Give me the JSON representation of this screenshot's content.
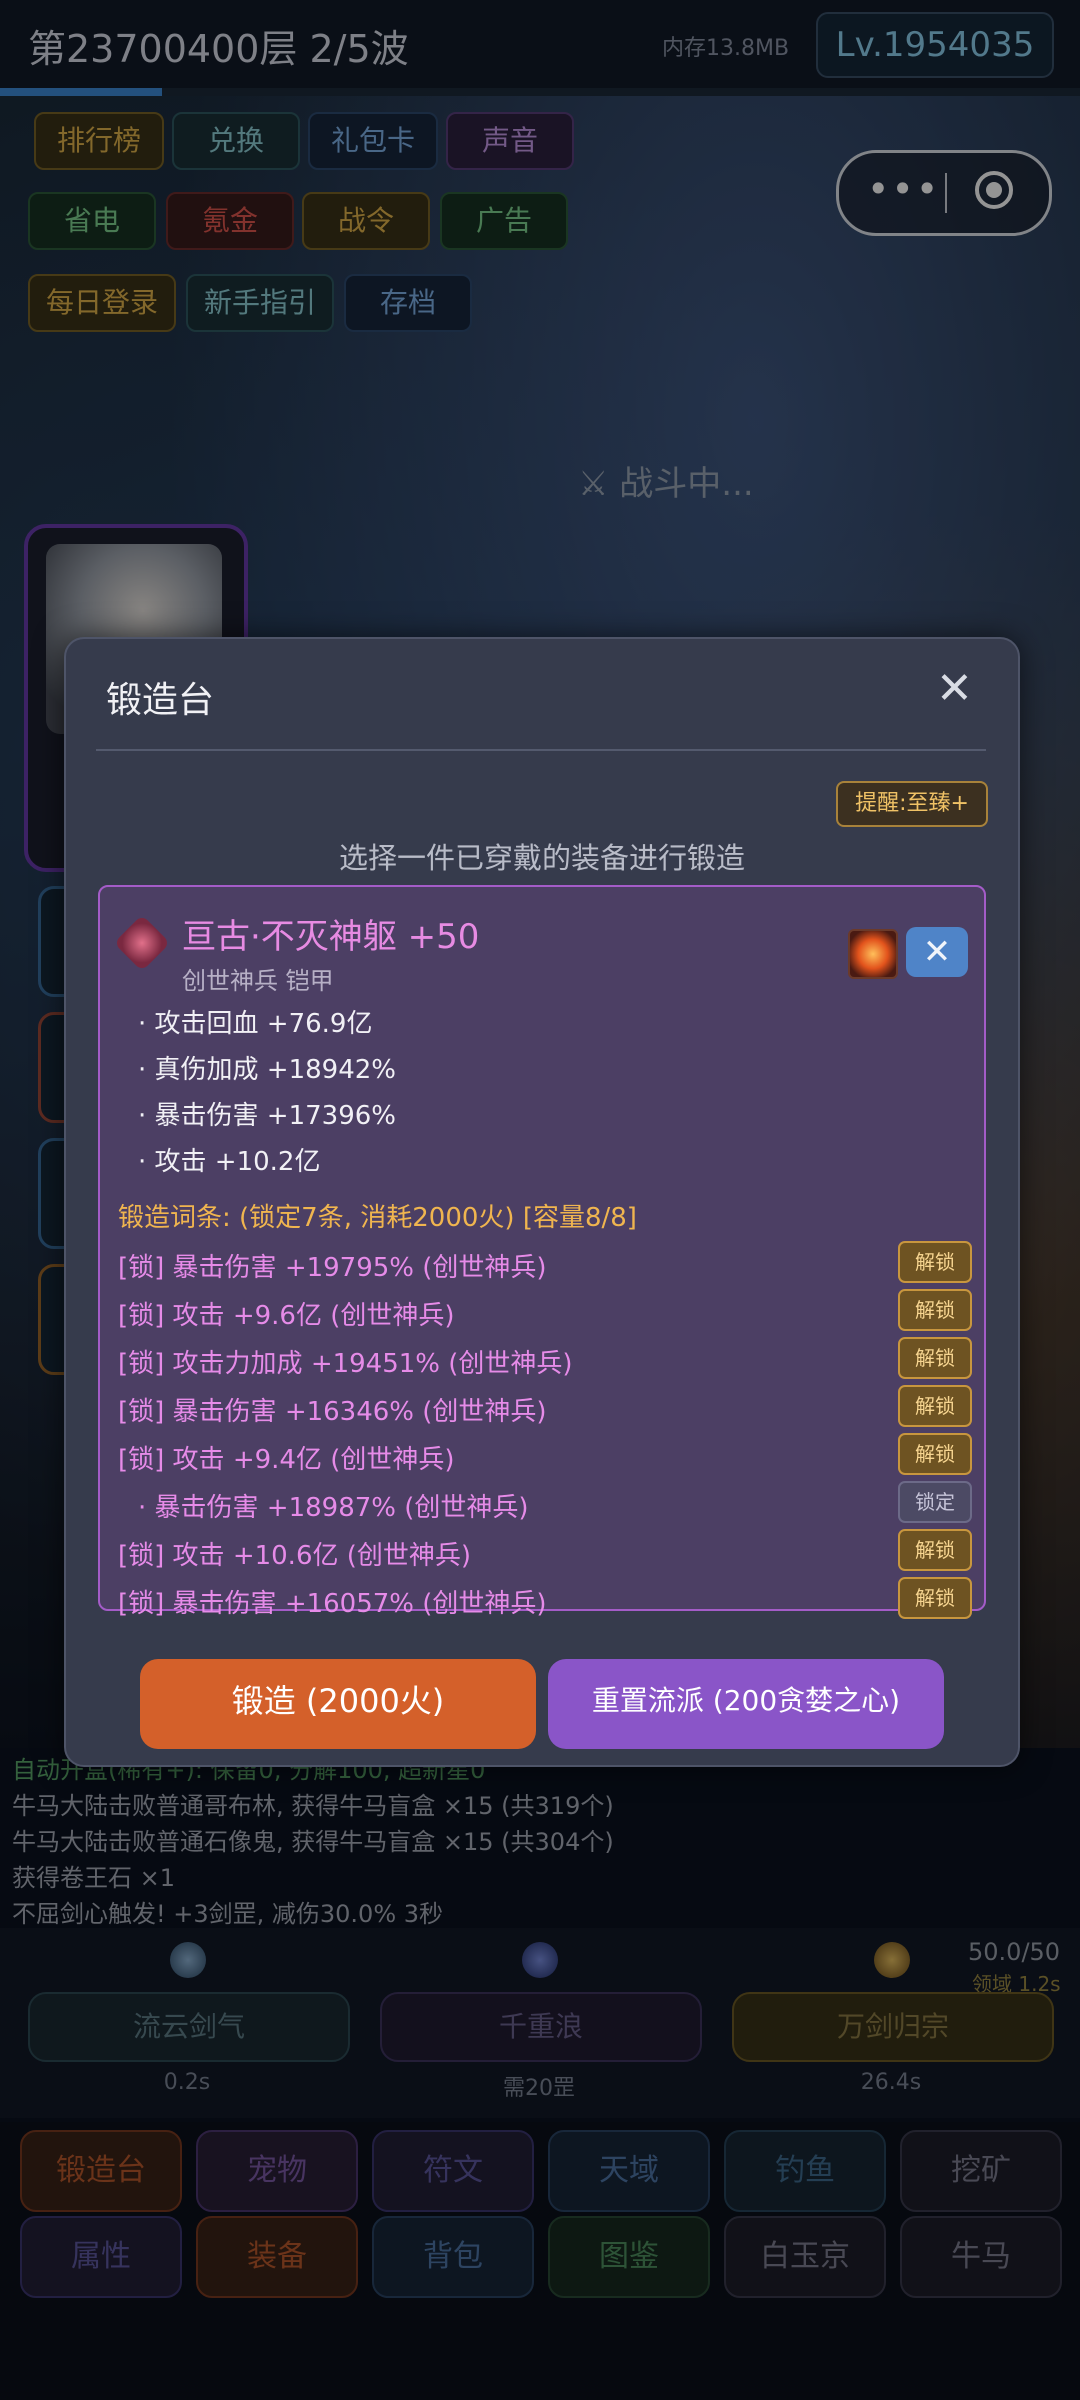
{
  "header": {
    "floor_wave": "第23700400层  2/5波",
    "memory": "内存13.8MB",
    "level": "Lv.1954035",
    "wave_progress": 0.15
  },
  "top_buttons": [
    "排行榜",
    "兑换",
    "礼包卡",
    "声音",
    "省电",
    "氪金",
    "战令",
    "广告",
    "每日登录",
    "新手指引",
    "存档"
  ],
  "battle_status": "⚔ 战斗中...",
  "modal": {
    "title": "锻造台",
    "close": "✕",
    "reminder": "提醒:至臻+",
    "instruction": "选择一件已穿戴的装备进行锻造",
    "equipment": {
      "name": "亘古·不灭神躯 +50",
      "type": "创世神兵 铠甲",
      "unequip": "✕",
      "base_stats": [
        "· 攻击回血 +76.9亿",
        "· 真伤加成 +18942%",
        "· 暴击伤害 +17396%",
        "· 攻击 +10.2亿"
      ],
      "forge_header": "锻造词条: (锁定7条, 消耗2000火) [容量8/8]",
      "affixes": [
        {
          "text": "[锁] 暴击伤害 +19795% (创世神兵)",
          "button": "解锁",
          "locked": true
        },
        {
          "text": "[锁] 攻击 +9.6亿 (创世神兵)",
          "button": "解锁",
          "locked": true
        },
        {
          "text": "[锁] 攻击力加成 +19451% (创世神兵)",
          "button": "解锁",
          "locked": true
        },
        {
          "text": "[锁] 暴击伤害 +16346% (创世神兵)",
          "button": "解锁",
          "locked": true
        },
        {
          "text": "[锁] 攻击 +9.4亿 (创世神兵)",
          "button": "解锁",
          "locked": true
        },
        {
          "text": "· 暴击伤害 +18987% (创世神兵)",
          "button": "锁定",
          "locked": false
        },
        {
          "text": "[锁] 攻击 +10.6亿 (创世神兵)",
          "button": "解锁",
          "locked": true
        },
        {
          "text": "[锁] 暴击伤害 +16057% (创世神兵)",
          "button": "解锁",
          "locked": true
        }
      ]
    },
    "forge_button": "锻造 (2000火)",
    "reset_button": "重置流派 (200贪婪之心)"
  },
  "log": [
    "自动开盒(稀有+): 保留0, 分解100, 超新星0",
    "牛马大陆击败普通哥布林, 获得牛马盲盒 ×15 (共319个)",
    "牛马大陆击败普通石像鬼, 获得牛马盲盒 ×15 (共304个)",
    "获得卷王石 ×1",
    "不屈剑心触发! +3剑罡, 减伤30.0% 3秒"
  ],
  "skills": [
    {
      "name": "流云剑气",
      "cooldown": "0.2s"
    },
    {
      "name": "千重浪",
      "cooldown": "需20罡"
    },
    {
      "name": "万剑归宗",
      "cooldown": "26.4s"
    }
  ],
  "energy": "50.0/50",
  "domain_timer": "领域 1.2s",
  "nav": [
    "锻造台",
    "宠物",
    "符文",
    "天域",
    "钓鱼",
    "挖矿",
    "属性",
    "装备",
    "背包",
    "图鉴",
    "白玉京",
    "牛马"
  ]
}
